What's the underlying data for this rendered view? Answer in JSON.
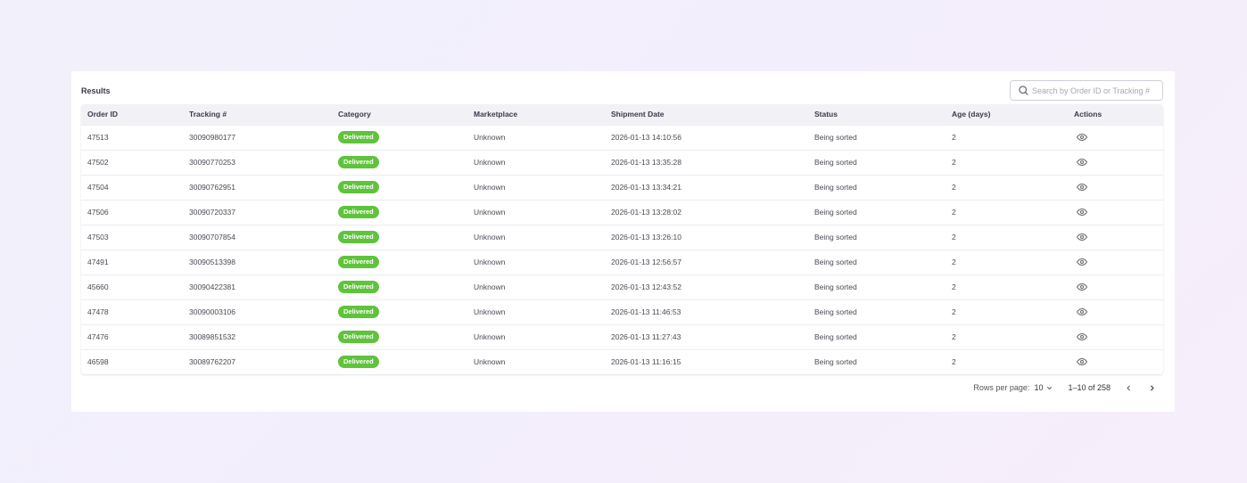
{
  "results": {
    "title": "Results",
    "search_placeholder": "Search by Order ID or Tracking #"
  },
  "table": {
    "columns": [
      "Order ID",
      "Tracking #",
      "Category",
      "Marketplace",
      "Shipment Date",
      "Status",
      "Age (days)",
      "Actions"
    ],
    "rows": [
      {
        "order_id": "47513",
        "tracking": "30090980177",
        "category": "Delivered",
        "marketplace": "Unknown",
        "shipment_date": "2026-01-13 14:10:56",
        "status": "Being sorted",
        "age": "2"
      },
      {
        "order_id": "47502",
        "tracking": "30090770253",
        "category": "Delivered",
        "marketplace": "Unknown",
        "shipment_date": "2026-01-13 13:35:28",
        "status": "Being sorted",
        "age": "2"
      },
      {
        "order_id": "47504",
        "tracking": "30090762951",
        "category": "Delivered",
        "marketplace": "Unknown",
        "shipment_date": "2026-01-13 13:34:21",
        "status": "Being sorted",
        "age": "2"
      },
      {
        "order_id": "47506",
        "tracking": "30090720337",
        "category": "Delivered",
        "marketplace": "Unknown",
        "shipment_date": "2026-01-13 13:28:02",
        "status": "Being sorted",
        "age": "2"
      },
      {
        "order_id": "47503",
        "tracking": "30090707854",
        "category": "Delivered",
        "marketplace": "Unknown",
        "shipment_date": "2026-01-13 13:26:10",
        "status": "Being sorted",
        "age": "2"
      },
      {
        "order_id": "47491",
        "tracking": "30090513398",
        "category": "Delivered",
        "marketplace": "Unknown",
        "shipment_date": "2026-01-13 12:56:57",
        "status": "Being sorted",
        "age": "2"
      },
      {
        "order_id": "45660",
        "tracking": "30090422381",
        "category": "Delivered",
        "marketplace": "Unknown",
        "shipment_date": "2026-01-13 12:43:52",
        "status": "Being sorted",
        "age": "2"
      },
      {
        "order_id": "47478",
        "tracking": "30090003106",
        "category": "Delivered",
        "marketplace": "Unknown",
        "shipment_date": "2026-01-13 11:46:53",
        "status": "Being sorted",
        "age": "2"
      },
      {
        "order_id": "47476",
        "tracking": "30089851532",
        "category": "Delivered",
        "marketplace": "Unknown",
        "shipment_date": "2026-01-13 11:27:43",
        "status": "Being sorted",
        "age": "2"
      },
      {
        "order_id": "46598",
        "tracking": "30089762207",
        "category": "Delivered",
        "marketplace": "Unknown",
        "shipment_date": "2026-01-13 11:16:15",
        "status": "Being sorted",
        "age": "2"
      }
    ],
    "action_icon": "eye-icon"
  },
  "pagination": {
    "rows_per_page_label": "Rows per page:",
    "rows_per_page_value": "10",
    "range_text": "1–10 of 258"
  },
  "colors": {
    "badge_delivered": "#5fc33b",
    "header_bg": "#f1f1f6"
  }
}
